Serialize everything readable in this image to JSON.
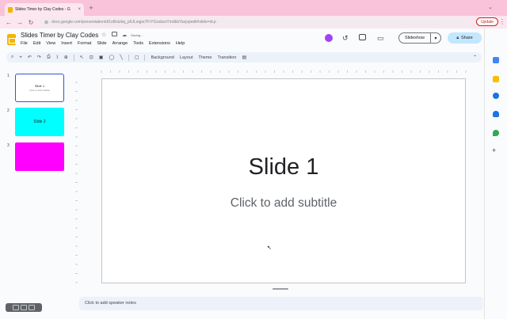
{
  "browser": {
    "tab_title": "Slides Timer by Clay Codes - G",
    "tab_close": "×",
    "new_tab": "+",
    "url": "docs.google.com/presentation/d/1eBxtzbq_p6JLsqpe7FrYGzsbsoYmdbkYavjxpedit#slide=id.p",
    "update_label": "Update",
    "nav_back": "←",
    "nav_forward": "→",
    "nav_reload": "↻"
  },
  "app": {
    "doc_title": "Slides Timer by Clay Codes",
    "saving_status": "Saving...",
    "menu": [
      "File",
      "Edit",
      "View",
      "Insert",
      "Format",
      "Slide",
      "Arrange",
      "Tools",
      "Extensions",
      "Help"
    ],
    "slideshow_label": "Slideshow",
    "share_label": "Share"
  },
  "toolbar": {
    "background_label": "Background",
    "layout_label": "Layout",
    "theme_label": "Theme",
    "transition_label": "Transition"
  },
  "filmstrip": {
    "slides": [
      {
        "number": "1",
        "label": "Slide 1",
        "sublabel": "Click to add subtitle",
        "color": "#ffffff"
      },
      {
        "number": "2",
        "label": "Slide 2",
        "color": "#00ffff"
      },
      {
        "number": "3",
        "label": "",
        "color": "#ff00ff"
      }
    ]
  },
  "slide": {
    "title": "Slide 1",
    "subtitle": "Click to add subtitle"
  },
  "notes": {
    "placeholder": "Click to add speaker notes"
  },
  "colors": {
    "accent": "#3c55c4",
    "share_bg": "#c2e7ff",
    "tab_strip": "#f9c3d9"
  }
}
